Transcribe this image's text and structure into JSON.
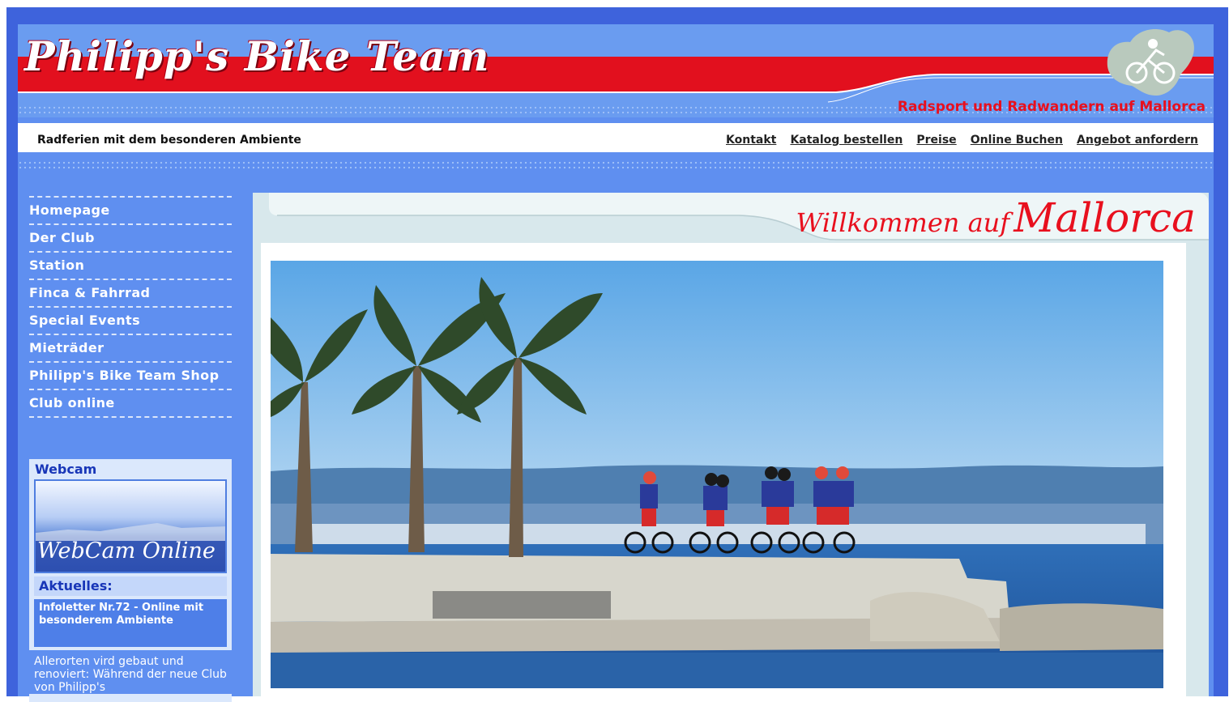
{
  "header": {
    "logo": "Philipp's Bike Team",
    "tagline": "Radsport und Radwandern auf Mallorca"
  },
  "subheader": {
    "slogan": "Radferien mit dem besonderen Ambiente",
    "links": [
      "Kontakt",
      "Katalog bestellen",
      "Preise",
      "Online Buchen",
      "Angebot anfordern"
    ]
  },
  "sidebar": {
    "items": [
      "Homepage",
      "Der Club",
      "Station",
      "Finca & Fahrrad",
      "Special Events",
      "Mieträder",
      "Philipp's Bike Team Shop",
      "Club online"
    ]
  },
  "webcam": {
    "title": "Webcam",
    "label": "WebCam Online"
  },
  "news": {
    "title": "Aktuelles:",
    "headline": "Infoletter Nr.72 - Online mit besonderem Ambiente",
    "body": "Allerorten vird gebaut und renoviert: Während der neue Club von Philipp's"
  },
  "main": {
    "welcome_1": "Willkommen auf",
    "welcome_2": "Mallorca"
  },
  "colors": {
    "frame": "#3e63dc",
    "panel": "#5f8ff0",
    "accent_red": "#e8101e"
  }
}
